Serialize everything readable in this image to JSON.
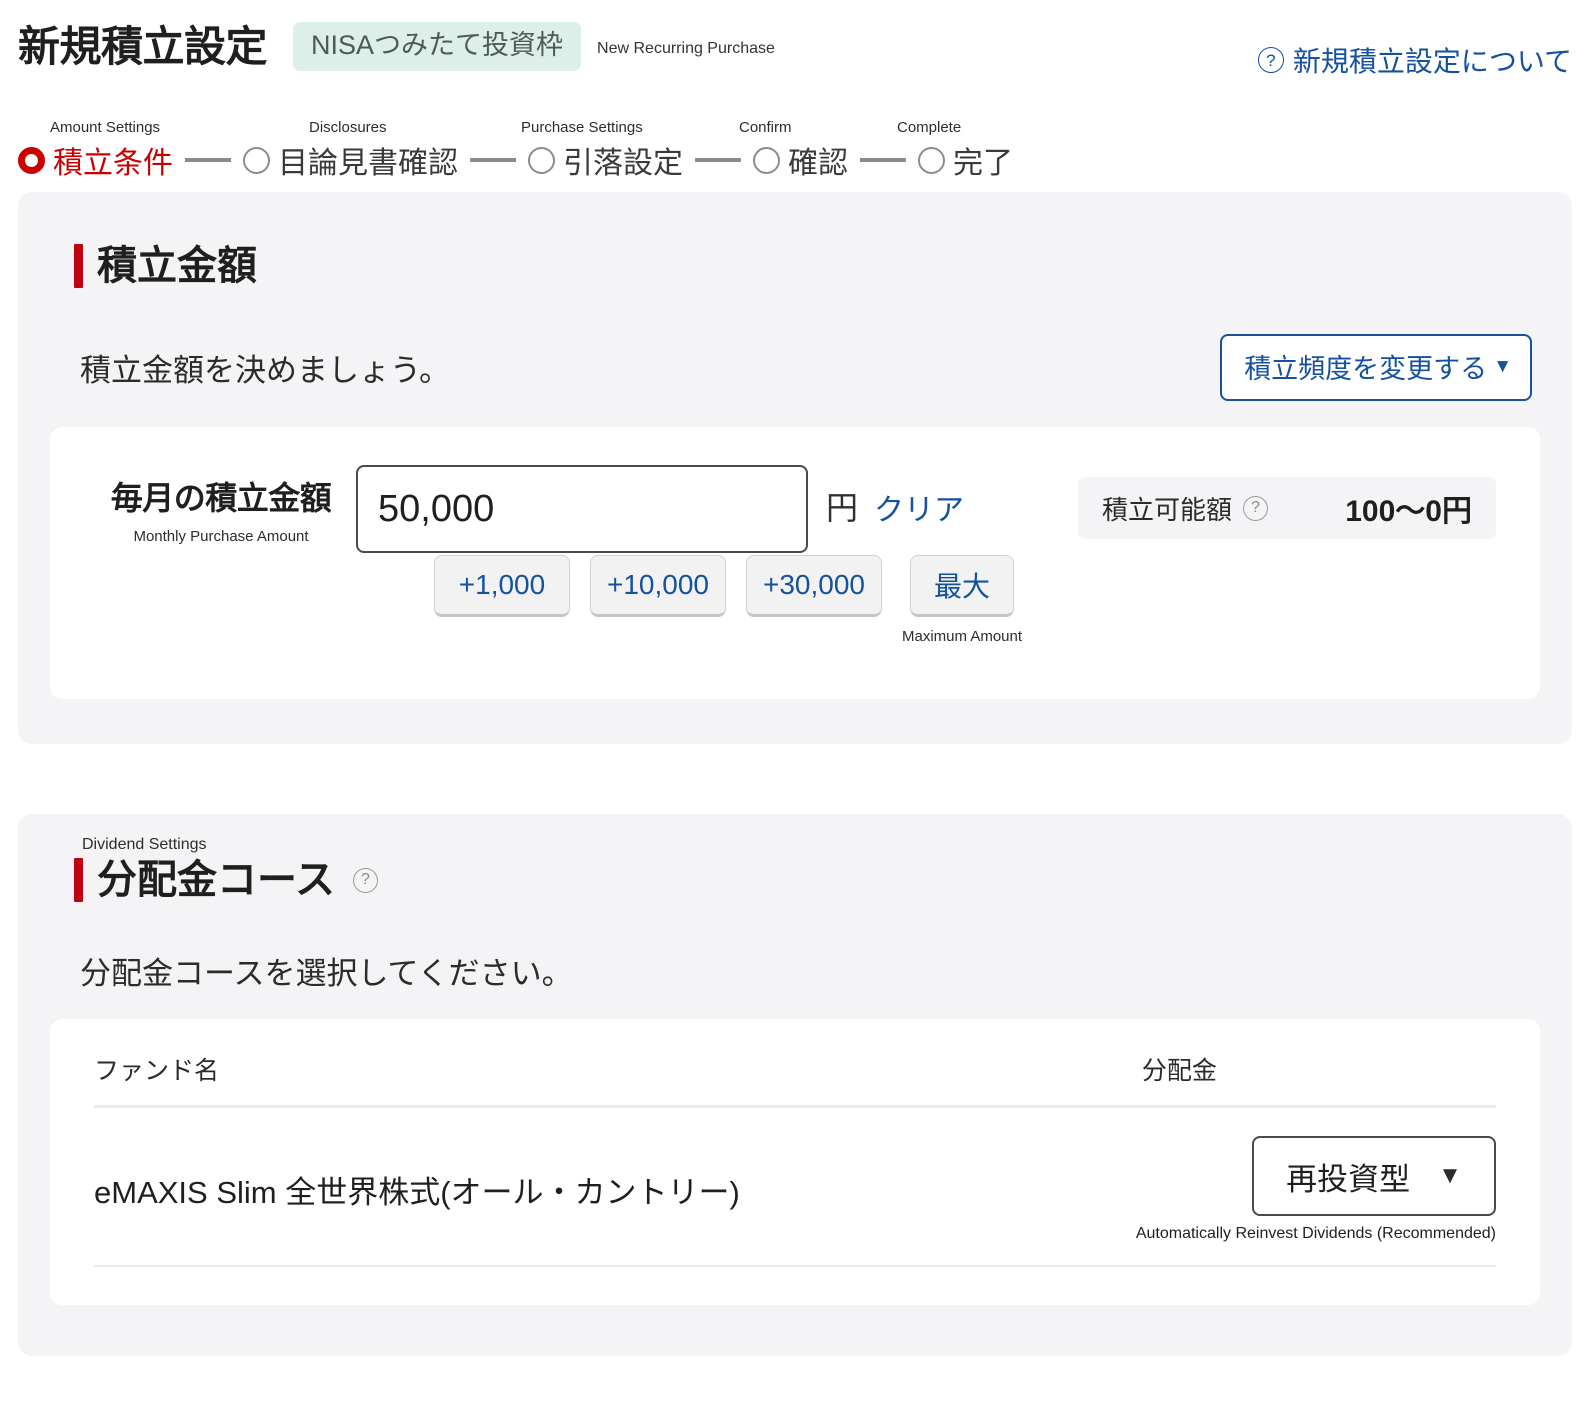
{
  "header": {
    "title": "新規積立設定",
    "badge": "NISAつみたて投資枠",
    "subtitle_en": "New Recurring Purchase",
    "help_link": "新規積立設定について",
    "help_icon": "question-circle-icon"
  },
  "stepper": {
    "steps": [
      {
        "label": "積立条件",
        "label_en": "Amount Settings",
        "active": true
      },
      {
        "label": "目論見書確認",
        "label_en": "Disclosures",
        "active": false
      },
      {
        "label": "引落設定",
        "label_en": "Purchase Settings",
        "active": false
      },
      {
        "label": "確認",
        "label_en": "Confirm",
        "active": false
      },
      {
        "label": "完了",
        "label_en": "Complete",
        "active": false
      }
    ],
    "active_color": "#cc0000",
    "inactive_color": "#8c8c8c"
  },
  "amount_section": {
    "title": "積立金額",
    "accent_color": "#c20012",
    "subtitle": "積立金額を決めましょう。",
    "frequency_button": "積立頻度を変更する",
    "frequency_caret": "▼",
    "amount_label_jp": "毎月の積立金額",
    "amount_label_en": "Monthly Purchase Amount",
    "amount_value": "50,000",
    "amount_placeholder": "0",
    "currency_unit": "円",
    "clear_link": "クリア",
    "quota_label": "積立可能額",
    "quota_help_icon": "question-circle-icon",
    "quota_value": "100〜0円",
    "quick_buttons": [
      {
        "label": "+1,000"
      },
      {
        "label": "+10,000"
      },
      {
        "label": "+30,000"
      }
    ],
    "max_button": "最大",
    "max_button_en": "Maximum Amount"
  },
  "dividend_section": {
    "title_en": "Dividend Settings",
    "title": "分配金コース",
    "title_help_icon": "question-circle-icon",
    "accent_color": "#c20012",
    "subtitle": "分配金コースを選択してください。",
    "table": {
      "headers": [
        "ファンド名",
        "分配金"
      ],
      "rows": [
        {
          "fund_name": "eMAXIS Slim 全世界株式(オール・カントリー)",
          "dividend_course": "再投資型",
          "dividend_caret": "▼",
          "dividend_caption": "Automatically Reinvest Dividends (Recommended)"
        }
      ]
    }
  }
}
